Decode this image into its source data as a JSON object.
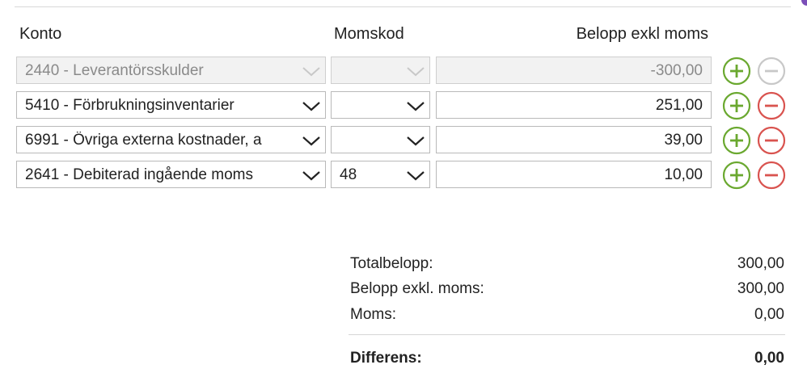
{
  "columns": {
    "konto": "Konto",
    "momskod": "Momskod",
    "belopp": "Belopp exkl moms"
  },
  "rows": [
    {
      "konto": "2440 - Leverantörsskulder",
      "momskod": "",
      "belopp": "-300,00",
      "disabled": true
    },
    {
      "konto": "5410 - Förbrukningsinventarier",
      "momskod": "",
      "belopp": "251,00",
      "disabled": false
    },
    {
      "konto": "6991 - Övriga externa kostnader, a",
      "momskod": "",
      "belopp": "39,00",
      "disabled": false
    },
    {
      "konto": "2641 - Debiterad ingående moms",
      "momskod": "48",
      "belopp": "10,00",
      "disabled": false
    }
  ],
  "summary": {
    "total_label": "Totalbelopp:",
    "total_value": "300,00",
    "exkl_label": "Belopp exkl. moms:",
    "exkl_value": "300,00",
    "moms_label": "Moms:",
    "moms_value": "0,00",
    "diff_label": "Differens:",
    "diff_value": "0,00"
  },
  "icons": {
    "add": "plus-circle-icon",
    "remove": "minus-circle-icon",
    "dropdown": "chevron-down-icon"
  },
  "colors": {
    "add": "#6aa82f",
    "remove": "#d9534f",
    "disabled": "#c8c8c8",
    "accent_dot": "#7b4fb8"
  }
}
